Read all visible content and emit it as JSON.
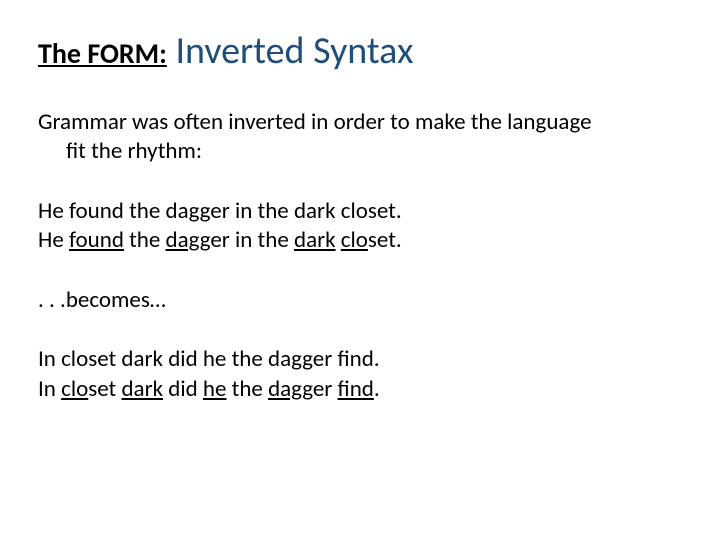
{
  "title": {
    "label": "The FORM:",
    "main": " Inverted Syntax"
  },
  "intro": {
    "line1": "Grammar was often inverted in order to make the language",
    "line2": "fit the rhythm:"
  },
  "ex1": {
    "plain": "He found the dagger in the dark closet.",
    "stress": {
      "he": "He ",
      "found": "found",
      "sp1": " the ",
      "dagger": "dag",
      "ger": "ger in the ",
      "dark": "dark",
      "sp2": " ",
      "clo": "clo",
      "set": "set."
    }
  },
  "transition": ". . .becomes…",
  "ex2": {
    "plain": "In closet dark did he the dagger find.",
    "stress": {
      "in": "In ",
      "clo": "clo",
      "set": "set ",
      "dark": "dark",
      "did": " did ",
      "he": "he",
      "the": " the ",
      "dag": "dag",
      "ger": "ger ",
      "find": "find",
      "dot": "."
    }
  }
}
